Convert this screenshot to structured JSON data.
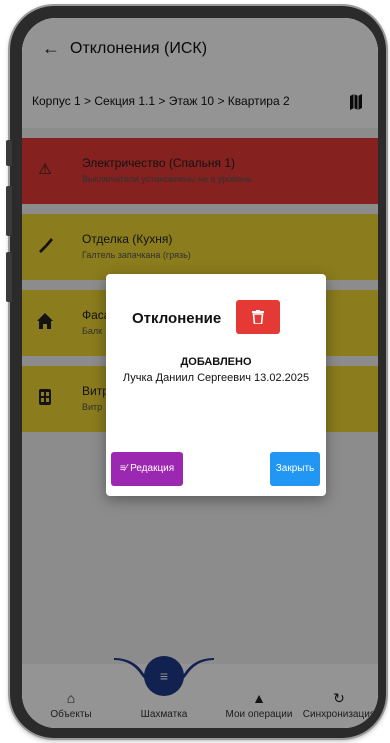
{
  "colors": {
    "danger": "#e53935",
    "warning": "#f0d633",
    "accent_purple": "#9c27b0",
    "accent_blue": "#2196f3",
    "fab_navy": "#1e3a8a"
  },
  "appbar": {
    "back_icon": "arrow-left-icon",
    "title": "Отклонения (ИСК)"
  },
  "breadcrumb": {
    "text": "Корпус 1 > Секция 1.1 > Этаж 10 > Квартира 2",
    "map_icon": "map-icon"
  },
  "items": [
    {
      "title": "Электричество (Спальня 1)",
      "subtitle": "Выключатели установлены не в уровень",
      "icon": "warning-icon",
      "color": "#e53935"
    },
    {
      "title": "Отделка (Кухня)",
      "subtitle": "Галтель запачкана (грязь)",
      "icon": "trowel-icon",
      "color": "#f0d633"
    },
    {
      "title": "Фаса",
      "subtitle": "Балк",
      "icon": "house-icon",
      "color": "#f0d633"
    },
    {
      "title": "Витр",
      "subtitle": "Витр",
      "icon": "window-icon",
      "color": "#f0d633"
    }
  ],
  "dialog": {
    "title": "Отклонение",
    "delete_icon": "trash-icon",
    "status": "ДОБАВЛЕНО",
    "author_date": "Лучка Даниил Сергеевич 13.02.2025",
    "edit_label": "Редакция",
    "edit_icon": "edit-list-icon",
    "close_label": "Закрыть"
  },
  "bottom_nav": [
    {
      "label": "Объекты",
      "icon": "home-icon"
    },
    {
      "label": "Шахматка",
      "icon": "checklist-icon"
    },
    {
      "label": "Мои операции",
      "icon": "bell-icon"
    },
    {
      "label": "Синхронизация",
      "icon": "sync-icon"
    }
  ]
}
